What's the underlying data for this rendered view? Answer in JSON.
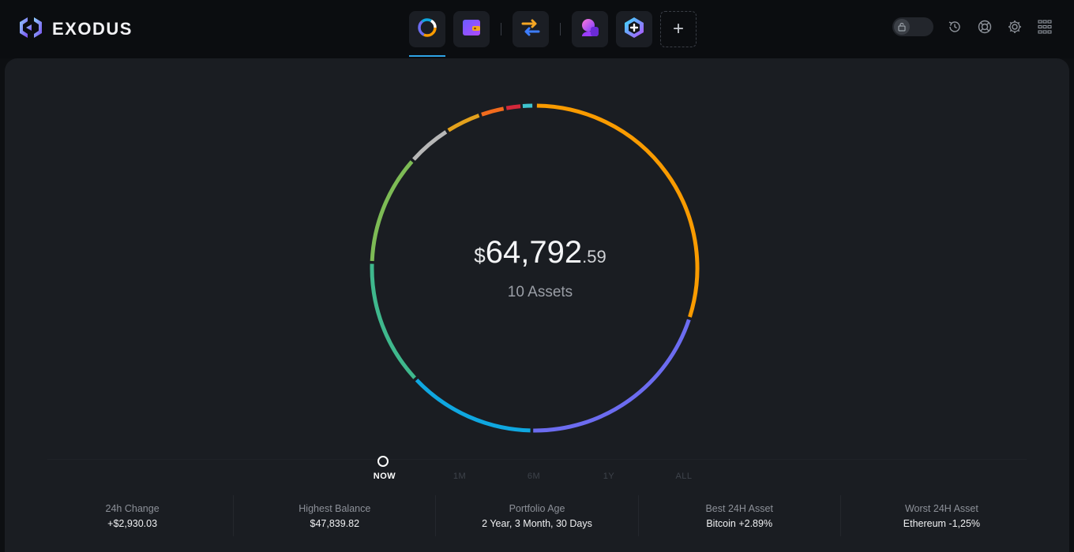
{
  "brand": {
    "name": "EXODUS"
  },
  "nav": {
    "items": [
      {
        "name": "portfolio",
        "icon": "portfolio-ring-icon",
        "active": true
      },
      {
        "name": "wallet",
        "icon": "wallet-icon",
        "active": false
      },
      {
        "name": "exchange",
        "icon": "exchange-arrows-icon",
        "active": false
      },
      {
        "name": "app-1",
        "icon": "app-profile-icon",
        "active": false
      },
      {
        "name": "app-2",
        "icon": "app-hexagon-plus-icon",
        "active": false
      }
    ],
    "add_label": "+"
  },
  "header_tools": [
    "lock-toggle-icon",
    "history-icon",
    "support-icon",
    "settings-icon",
    "apps-grid-icon"
  ],
  "portfolio": {
    "currency_symbol": "$",
    "balance_main": "64,792",
    "balance_cents": ".59",
    "assets_label": "10 Assets"
  },
  "allocation_colors": [
    "#f99b00",
    "#6c6cf0",
    "#0fa7e0",
    "#3fb88d",
    "#7dbb55",
    "#b7b7b7",
    "#e3a11c",
    "#f26b1d",
    "#d3283a",
    "#3fc4cf"
  ],
  "timeline": {
    "labels": [
      "NOW",
      "1M",
      "6M",
      "1Y",
      "ALL"
    ],
    "active": "NOW"
  },
  "stats": [
    {
      "label": "24h Change",
      "value": "+$2,930.03"
    },
    {
      "label": "Highest Balance",
      "value": "$47,839.82"
    },
    {
      "label": "Portfolio Age",
      "value": "2 Year, 3 Month, 30 Days"
    },
    {
      "label": "Best 24H Asset",
      "value": "Bitcoin +2.89%"
    },
    {
      "label": "Worst 24H Asset",
      "value": "Ethereum -1,25%"
    }
  ]
}
